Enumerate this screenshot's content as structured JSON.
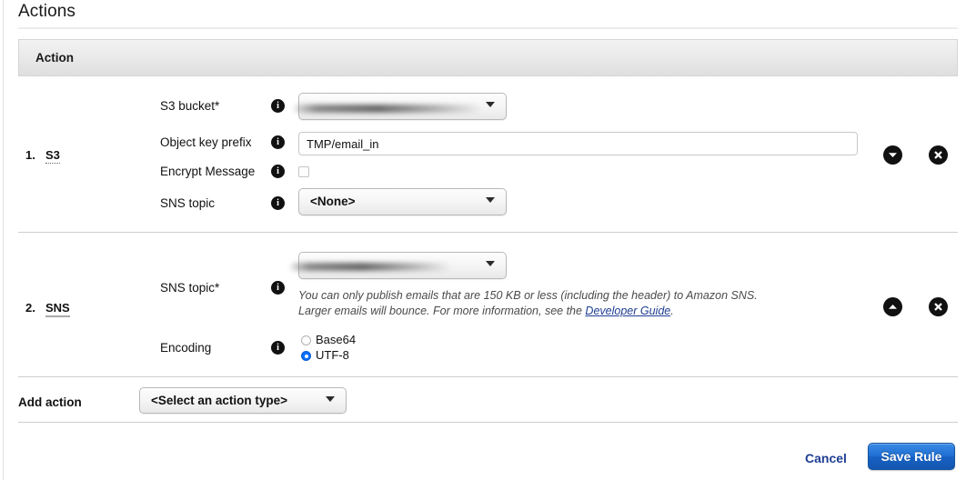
{
  "page": {
    "title": "Actions"
  },
  "table": {
    "header": "Action"
  },
  "actions": [
    {
      "index": "1.",
      "type": "S3",
      "fields": {
        "s3_bucket": {
          "label": "S3 bucket*",
          "value": "",
          "redacted": true
        },
        "object_key_prefix": {
          "label": "Object key prefix",
          "value": "TMP/email_in"
        },
        "encrypt_message": {
          "label": "Encrypt Message",
          "checked": false
        },
        "sns_topic": {
          "label": "SNS topic",
          "value": "<None>"
        }
      },
      "controls": {
        "move": "chevron-down",
        "remove": "x"
      }
    },
    {
      "index": "2.",
      "type": "SNS",
      "fields": {
        "sns_topic": {
          "label": "SNS topic*",
          "value": "",
          "redacted": true
        },
        "note": {
          "line1": "You can only publish emails that are 150 KB or less (including the header) to Amazon SNS.",
          "line2_pre": "Larger emails will bounce. For more information, see the ",
          "link": "Developer Guide",
          "line2_post": "."
        },
        "encoding": {
          "label": "Encoding",
          "options": [
            {
              "label": "Base64",
              "selected": false
            },
            {
              "label": "UTF-8",
              "selected": true
            }
          ]
        }
      },
      "controls": {
        "move": "chevron-up",
        "remove": "x"
      }
    }
  ],
  "add_action": {
    "label": "Add action",
    "select_value": "<Select an action type>"
  },
  "footer": {
    "cancel": "Cancel",
    "save": "Save Rule"
  },
  "colors": {
    "accent_blue": "#1f6fd4",
    "link_blue": "#1f3e94",
    "radio_selected": "#0d6efd",
    "header_bg": "#eaeaea"
  }
}
